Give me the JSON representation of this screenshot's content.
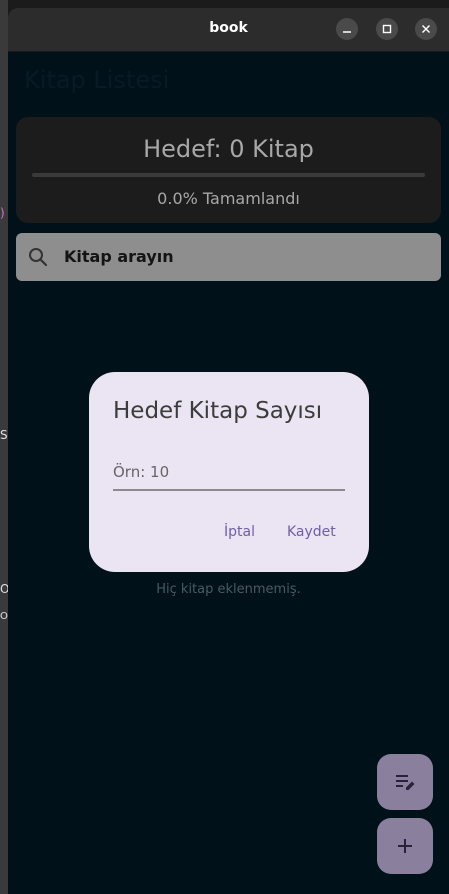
{
  "window": {
    "title": "book",
    "minimize_label": "–",
    "maximize_label": "☐",
    "close_label": "✕"
  },
  "background_fragments": [
    ")",
    "S",
    "O",
    "OM"
  ],
  "app": {
    "title": "Kitap Listesi"
  },
  "goal_card": {
    "title": "Hedef: 0 Kitap",
    "progress": 0.0,
    "percent_text": "0.0% Tamamlandı"
  },
  "search": {
    "placeholder": "Kitap arayın",
    "icon": "search-icon"
  },
  "empty_state": {
    "text": "Hiç kitap eklenmemiş."
  },
  "fabs": [
    {
      "icon": "edit-note-icon"
    },
    {
      "icon": "plus-icon",
      "glyph": "+"
    }
  ],
  "dialog": {
    "title": "Hedef Kitap Sayısı",
    "input_placeholder": "Örn: 10",
    "input_value": "",
    "cancel_label": "İptal",
    "save_label": "Kaydet"
  },
  "colors": {
    "background": "#01111a",
    "titlebar": "#2c2c2c",
    "dialog_bg": "#ebe4f2",
    "accent": "#6d5fa8",
    "fab": "#8a7f9c"
  }
}
